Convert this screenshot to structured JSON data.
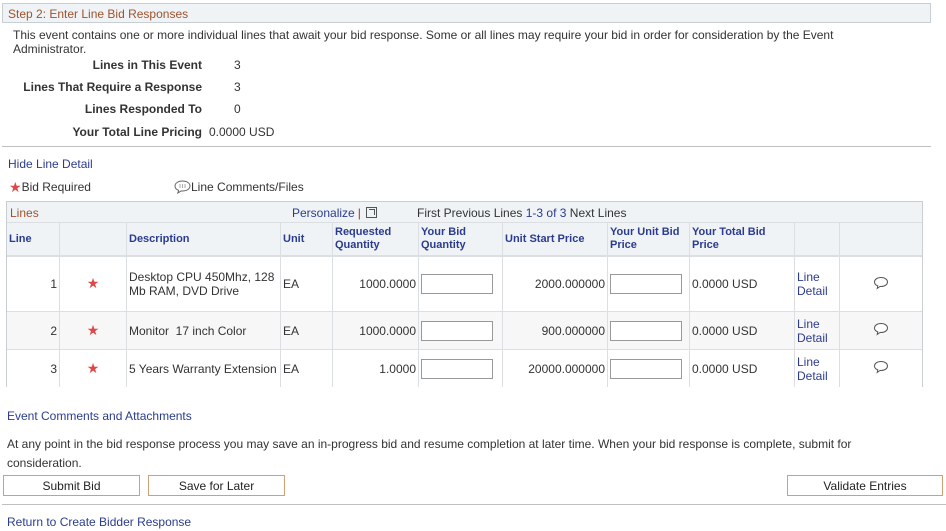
{
  "step_header": "Step 2: Enter Line Bid Responses",
  "intro_text": "This event contains one or more individual lines that await your bid response. Some or all lines may require your bid in order for consideration by the Event Administrator.",
  "summary": [
    {
      "label": "Lines in This Event",
      "value": "3"
    },
    {
      "label": "Lines That Require a Response",
      "value": "3"
    },
    {
      "label": "Lines Responded To",
      "value": "0"
    },
    {
      "label": "Your Total Line Pricing",
      "value": "0.0000 USD"
    }
  ],
  "hide_line_detail": "Hide Line Detail",
  "legend": {
    "bid_required": "Bid Required",
    "line_comments": "Line Comments/Files"
  },
  "grid": {
    "title": "Lines",
    "personalize": "Personalize",
    "separator": "|",
    "nav": {
      "first": "First",
      "previous": "Previous Lines",
      "range": "1-3 of 3",
      "next": "Next Lines"
    },
    "columns": [
      "Line",
      "",
      "Description",
      "Unit",
      "Requested Quantity",
      "Your Bid Quantity",
      "Unit Start Price",
      "Your Unit Bid Price",
      "Your Total Bid Price",
      "",
      ""
    ],
    "rows": [
      {
        "line": "1",
        "description": "Desktop CPU 450Mhz, 128 Mb RAM, DVD Drive",
        "unit": "EA",
        "requested_qty": "1000.0000",
        "bid_qty": "",
        "unit_start_price": "2000.000000",
        "unit_bid_price": "",
        "total_bid_price": "0.0000 USD",
        "detail_link": "Line Detail"
      },
      {
        "line": "2",
        "description": "Monitor  17 inch Color",
        "unit": "EA",
        "requested_qty": "1000.0000",
        "bid_qty": "",
        "unit_start_price": "900.000000",
        "unit_bid_price": "",
        "total_bid_price": "0.0000 USD",
        "detail_link": "Line Detail"
      },
      {
        "line": "3",
        "description": "5 Years Warranty Extension",
        "unit": "EA",
        "requested_qty": "1.0000",
        "bid_qty": "",
        "unit_start_price": "20000.000000",
        "unit_bid_price": "",
        "total_bid_price": "0.0000 USD",
        "detail_link": "Line Detail"
      }
    ]
  },
  "event_comments_link": "Event Comments and Attachments",
  "save_note": "At any point in the bid response process you may save an in-progress bid and resume completion at later time. When your bid response is complete, submit for consideration.",
  "buttons": {
    "submit": "Submit Bid",
    "save_later": "Save for Later",
    "validate": "Validate Entries"
  },
  "return_link": "Return to Create Bidder Response",
  "colors": {
    "header_text": "#a0522d",
    "link": "#2b3c8f",
    "required_star": "#e04848",
    "button_border": "#cf9f76"
  }
}
